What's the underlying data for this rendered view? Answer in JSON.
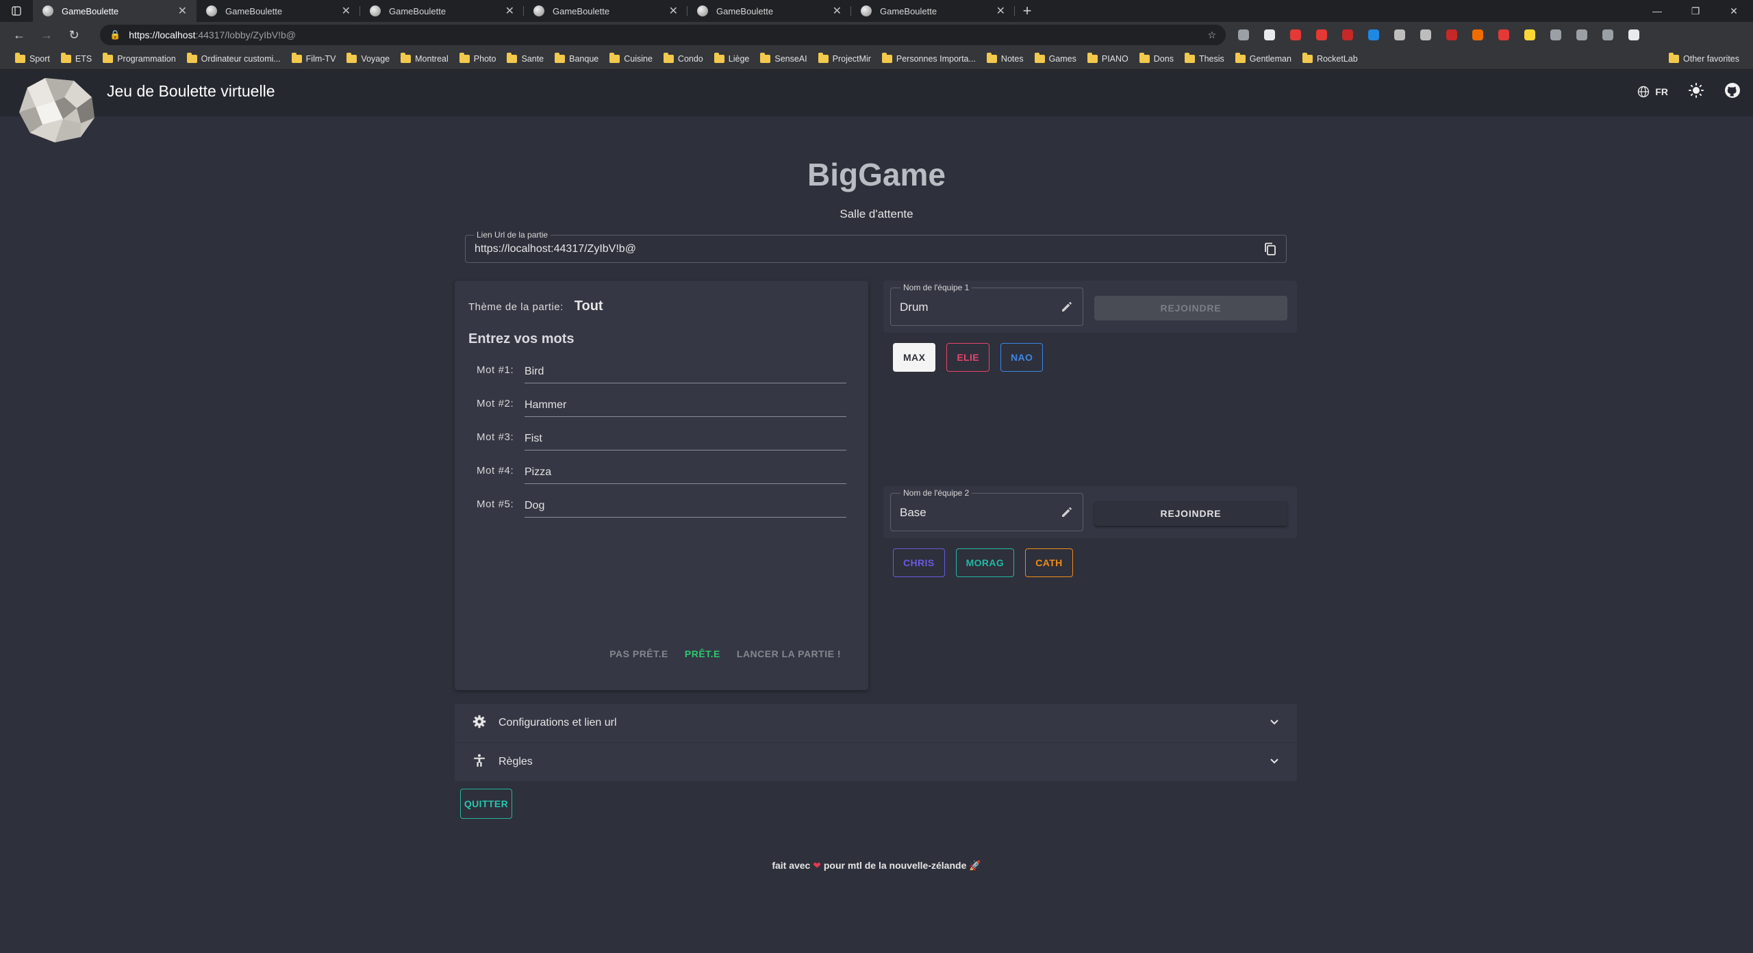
{
  "browser": {
    "tabs": [
      {
        "title": "GameBoulette",
        "active": true
      },
      {
        "title": "GameBoulette",
        "active": false
      },
      {
        "title": "GameBoulette",
        "active": false
      },
      {
        "title": "GameBoulette",
        "active": false
      },
      {
        "title": "GameBoulette",
        "active": false
      },
      {
        "title": "GameBoulette",
        "active": false
      }
    ],
    "url_host": "https://localhost",
    "url_path": ":44317/lobby/ZyIbV!b@",
    "bookmarks": [
      "Sport",
      "ETS",
      "Programmation",
      "Ordinateur customi...",
      "Film-TV",
      "Voyage",
      "Montreal",
      "Photo",
      "Sante",
      "Banque",
      "Cuisine",
      "Condo",
      "Liège",
      "SenseAI",
      "ProjectMir",
      "Personnes Importa...",
      "Notes",
      "Games",
      "PIANO",
      "Dons",
      "Thesis",
      "Gentleman",
      "RocketLab"
    ],
    "other_bookmarks": "Other favorites",
    "extension_colors": [
      "#9aa0a6",
      "#e8eaed",
      "#e53935",
      "#e53935",
      "#c62828",
      "#1e88e5",
      "#bdbdbd",
      "#bdbdbd",
      "#c62828",
      "#ef6c00",
      "#e53935",
      "#fdd835",
      "#9aa0a6",
      "#9aa0a6",
      "#9aa0a6",
      "#e8eaed"
    ]
  },
  "app": {
    "title": "Jeu de Boulette virtuelle",
    "lang": "FR"
  },
  "lobby": {
    "game_name": "BigGame",
    "subtitle": "Salle d'attente",
    "url_label": "Lien Url de la partie",
    "url_value": "https://localhost:44317/ZyIbV!b@",
    "theme_label": "Thème de la partie:",
    "theme_value": "Tout",
    "words_heading": "Entrez vos mots",
    "words": [
      {
        "label": "Mot #1:",
        "value": "Bird"
      },
      {
        "label": "Mot #2:",
        "value": "Hammer"
      },
      {
        "label": "Mot #3:",
        "value": "Fist"
      },
      {
        "label": "Mot #4:",
        "value": "Pizza"
      },
      {
        "label": "Mot #5:",
        "value": "Dog"
      }
    ],
    "actions": {
      "not_ready": "PAS PRÊT.E",
      "ready": "PRÊT.E",
      "start": "LANCER LA PARTIE !"
    },
    "teams": [
      {
        "label": "Nom de l'équipe 1",
        "name": "Drum",
        "join": "REJOINDRE",
        "join_enabled": false,
        "players": [
          {
            "name": "MAX",
            "color": "#2e303b",
            "bg": "#f4f4f4",
            "border": "#f4f4f4"
          },
          {
            "name": "ELIE",
            "color": "#e8456c",
            "bg": "transparent",
            "border": "#e8456c"
          },
          {
            "name": "NAO",
            "color": "#3d86e8",
            "bg": "transparent",
            "border": "#3d86e8"
          }
        ]
      },
      {
        "label": "Nom de l'équipe 2",
        "name": "Base",
        "join": "REJOINDRE",
        "join_enabled": true,
        "players": [
          {
            "name": "CHRIS",
            "color": "#6a5ae0",
            "bg": "transparent",
            "border": "#6a5ae0"
          },
          {
            "name": "MORAG",
            "color": "#23b8a5",
            "bg": "transparent",
            "border": "#23b8a5"
          },
          {
            "name": "CATH",
            "color": "#ef8c1a",
            "bg": "transparent",
            "border": "#ef8c1a"
          }
        ]
      }
    ],
    "accordions": [
      {
        "label": "Configurations et lien url",
        "icon": "gear-icon"
      },
      {
        "label": "Règles",
        "icon": "accessibility-icon"
      }
    ],
    "quit": "QUITTER"
  },
  "footer": {
    "prefix": "fait avec",
    "suffix": "pour mtl de la nouvelle-zélande"
  }
}
